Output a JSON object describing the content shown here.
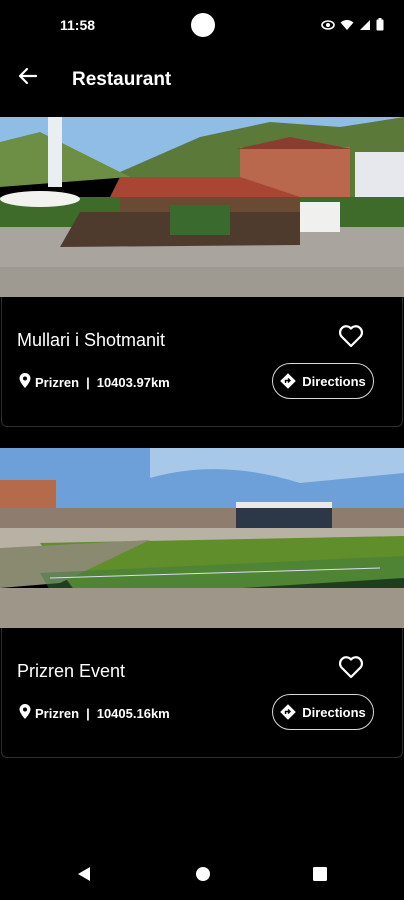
{
  "status_bar": {
    "time": "11:58",
    "icons": [
      "eye-icon",
      "wifi-icon",
      "signal-icon",
      "battery-icon"
    ]
  },
  "app_bar": {
    "title": "Restaurant",
    "back_icon": "arrow-left-icon"
  },
  "cards": [
    {
      "title": "Mullari i Shotmanit",
      "city": "Prizren",
      "separator": "|",
      "distance": "10403.97km",
      "directions_label": "Directions",
      "favorite": false
    },
    {
      "title": "Prizren Event",
      "city": "Prizren",
      "separator": "|",
      "distance": "10405.16km",
      "directions_label": "Directions",
      "favorite": false
    }
  ],
  "nav_bar": {
    "buttons": [
      "back-triangle-icon",
      "home-circle-icon",
      "recents-square-icon"
    ]
  },
  "colors": {
    "background": "#000000",
    "text": "#ffffff",
    "card_border": "#2e2e2e",
    "button_border": "#d8d8d8"
  }
}
